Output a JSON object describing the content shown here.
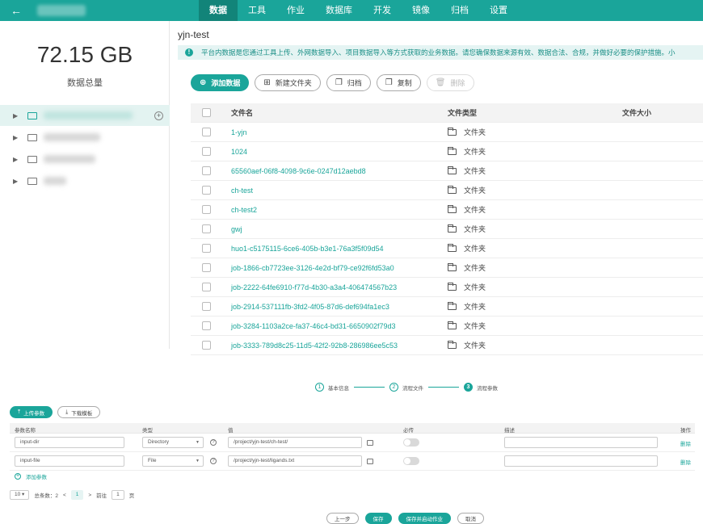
{
  "topbar": {
    "nav": [
      {
        "label": "数据",
        "active": true
      },
      {
        "label": "工具",
        "active": false
      },
      {
        "label": "作业",
        "active": false
      },
      {
        "label": "数据库",
        "active": false
      },
      {
        "label": "开发",
        "active": false
      },
      {
        "label": "镜像",
        "active": false
      },
      {
        "label": "归档",
        "active": false
      },
      {
        "label": "设置",
        "active": false
      }
    ]
  },
  "sidebar": {
    "total_size": "72.15 GB",
    "total_label": "数据总量"
  },
  "main": {
    "breadcrumb": "yjn-test",
    "notice": "平台内数据是您通过工具上传、外网数据导入、项目数据导入等方式获取的业务数据。请您确保数据来源有效、数据合法、合规，并做好必要的保护措施。小",
    "toolbar": {
      "add": "添加数据",
      "new_folder": "新建文件夹",
      "archive": "归档",
      "copy": "复制",
      "delete": "删除"
    },
    "table": {
      "headers": {
        "name": "文件名",
        "type": "文件类型",
        "size": "文件大小"
      },
      "rows": [
        {
          "name": "1-yjn",
          "type": "文件夹"
        },
        {
          "name": "1024",
          "type": "文件夹"
        },
        {
          "name": "65560aef-06f8-4098-9c6e-0247d12aebd8",
          "type": "文件夹"
        },
        {
          "name": "ch-test",
          "type": "文件夹"
        },
        {
          "name": "ch-test2",
          "type": "文件夹"
        },
        {
          "name": "gwj",
          "type": "文件夹"
        },
        {
          "name": "huo1-c5175115-6ce6-405b-b3e1-76a3f5f09d54",
          "type": "文件夹"
        },
        {
          "name": "job-1866-cb7723ee-3126-4e2d-bf79-ce92f6fd53a0",
          "type": "文件夹"
        },
        {
          "name": "job-2222-64fe6910-f77d-4b30-a3a4-406474567b23",
          "type": "文件夹"
        },
        {
          "name": "job-2914-537111fb-3fd2-4f05-87d6-def694fa1ec3",
          "type": "文件夹"
        },
        {
          "name": "job-3284-1103a2ce-fa37-46c4-bd31-6650902f79d3",
          "type": "文件夹"
        },
        {
          "name": "job-3333-789d8c25-11d5-42f2-92b8-286986ee5c53",
          "type": "文件夹"
        }
      ]
    }
  },
  "wizard": {
    "steps": [
      {
        "num": "1",
        "label": "基本信息"
      },
      {
        "num": "2",
        "label": "流程文件"
      },
      {
        "num": "3",
        "label": "流程参数"
      }
    ],
    "actions": {
      "upload": "上传参数",
      "download": "下载模板"
    },
    "param_headers": {
      "name": "参数名称",
      "type": "类型",
      "value": "值",
      "required": "必传",
      "desc": "描述",
      "op": "操作"
    },
    "params": [
      {
        "name": "input-dir",
        "type": "Directory",
        "value": "/project/yjn-test/ch-test/",
        "required": false,
        "desc": "",
        "op": "删除"
      },
      {
        "name": "input-file",
        "type": "File",
        "value": "/project/yjn-test/ligands.txt",
        "required": false,
        "desc": "",
        "op": "删除"
      }
    ],
    "add_param": "添加参数",
    "pager": {
      "page_size": "10",
      "total": "总条数：2",
      "prev": "<",
      "current": "1",
      "next": ">",
      "goto_label": "前往",
      "goto_value": "1",
      "page_unit": "页"
    },
    "buttons": {
      "prev": "上一步",
      "save": "保存",
      "save_run": "保存并启动作业",
      "cancel": "取消"
    }
  },
  "colors": {
    "accent": "#1aa59a",
    "accent_dark": "#128479",
    "notice_bg": "#e5f4f3"
  }
}
